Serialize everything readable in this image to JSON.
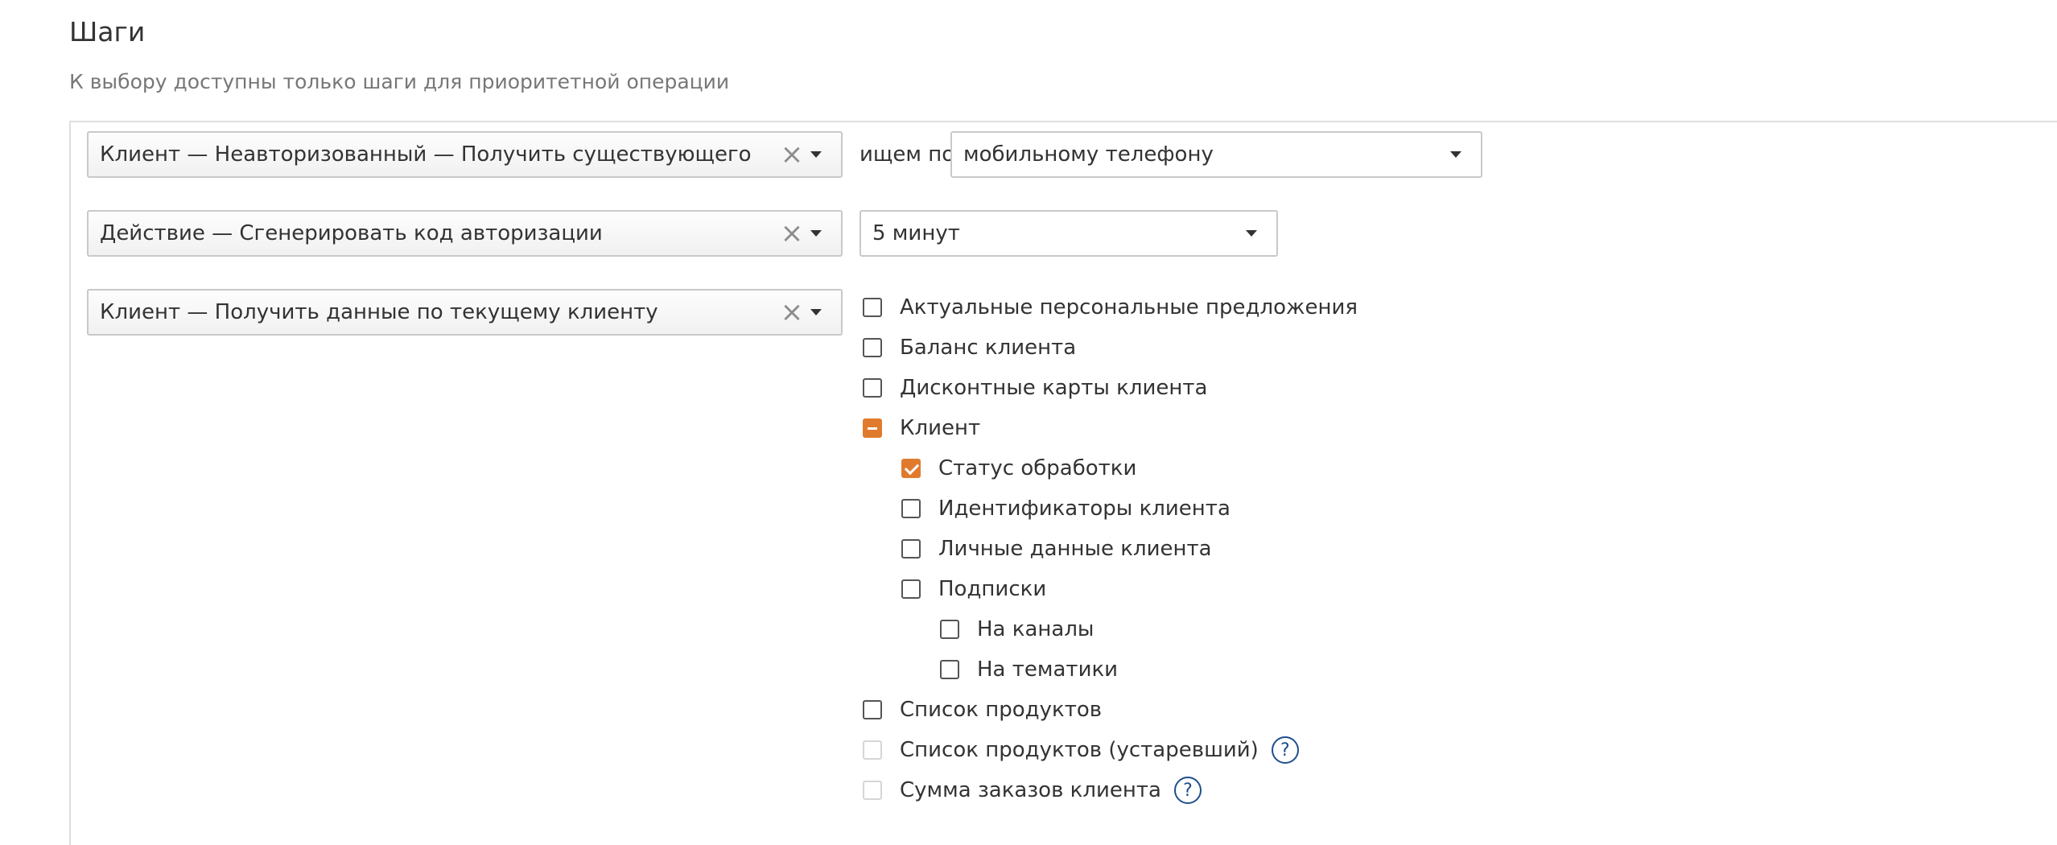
{
  "header": {
    "title": "Шаги",
    "subtitle": "К выбору доступны только шаги для приоритетной операции"
  },
  "steps": [
    {
      "value": "Клиент — Неавторизованный — Получить существующего",
      "param_label": "ищем по",
      "param_value": "мобильному телефону"
    },
    {
      "value": "Действие — Сгенерировать код авторизации",
      "param_value": "5 минут"
    },
    {
      "value": "Клиент — Получить данные по текущему клиенту"
    }
  ],
  "options": [
    {
      "label": "Актуальные персональные предложения",
      "state": "unchecked"
    },
    {
      "label": "Баланс клиента",
      "state": "unchecked"
    },
    {
      "label": "Дисконтные карты клиента",
      "state": "unchecked"
    },
    {
      "label": "Клиент",
      "state": "mixed"
    },
    {
      "label": "Статус обработки",
      "state": "checked"
    },
    {
      "label": "Идентификаторы клиента",
      "state": "unchecked"
    },
    {
      "label": "Личные данные клиента",
      "state": "unchecked"
    },
    {
      "label": "Подписки",
      "state": "unchecked"
    },
    {
      "label": "На каналы",
      "state": "unchecked"
    },
    {
      "label": "На тематики",
      "state": "unchecked"
    },
    {
      "label": "Список продуктов",
      "state": "unchecked"
    },
    {
      "label": "Список продуктов (устаревший)",
      "state": "disabled"
    },
    {
      "label": "Сумма заказов клиента",
      "state": "disabled"
    }
  ],
  "icons": {
    "clear": "close-icon",
    "caret": "chevron-down-icon",
    "help": "question-circle-icon",
    "help_glyph": "?"
  },
  "colors": {
    "accent": "#e07b2e",
    "help": "#1f4e8c",
    "border": "#c9c9c9"
  }
}
